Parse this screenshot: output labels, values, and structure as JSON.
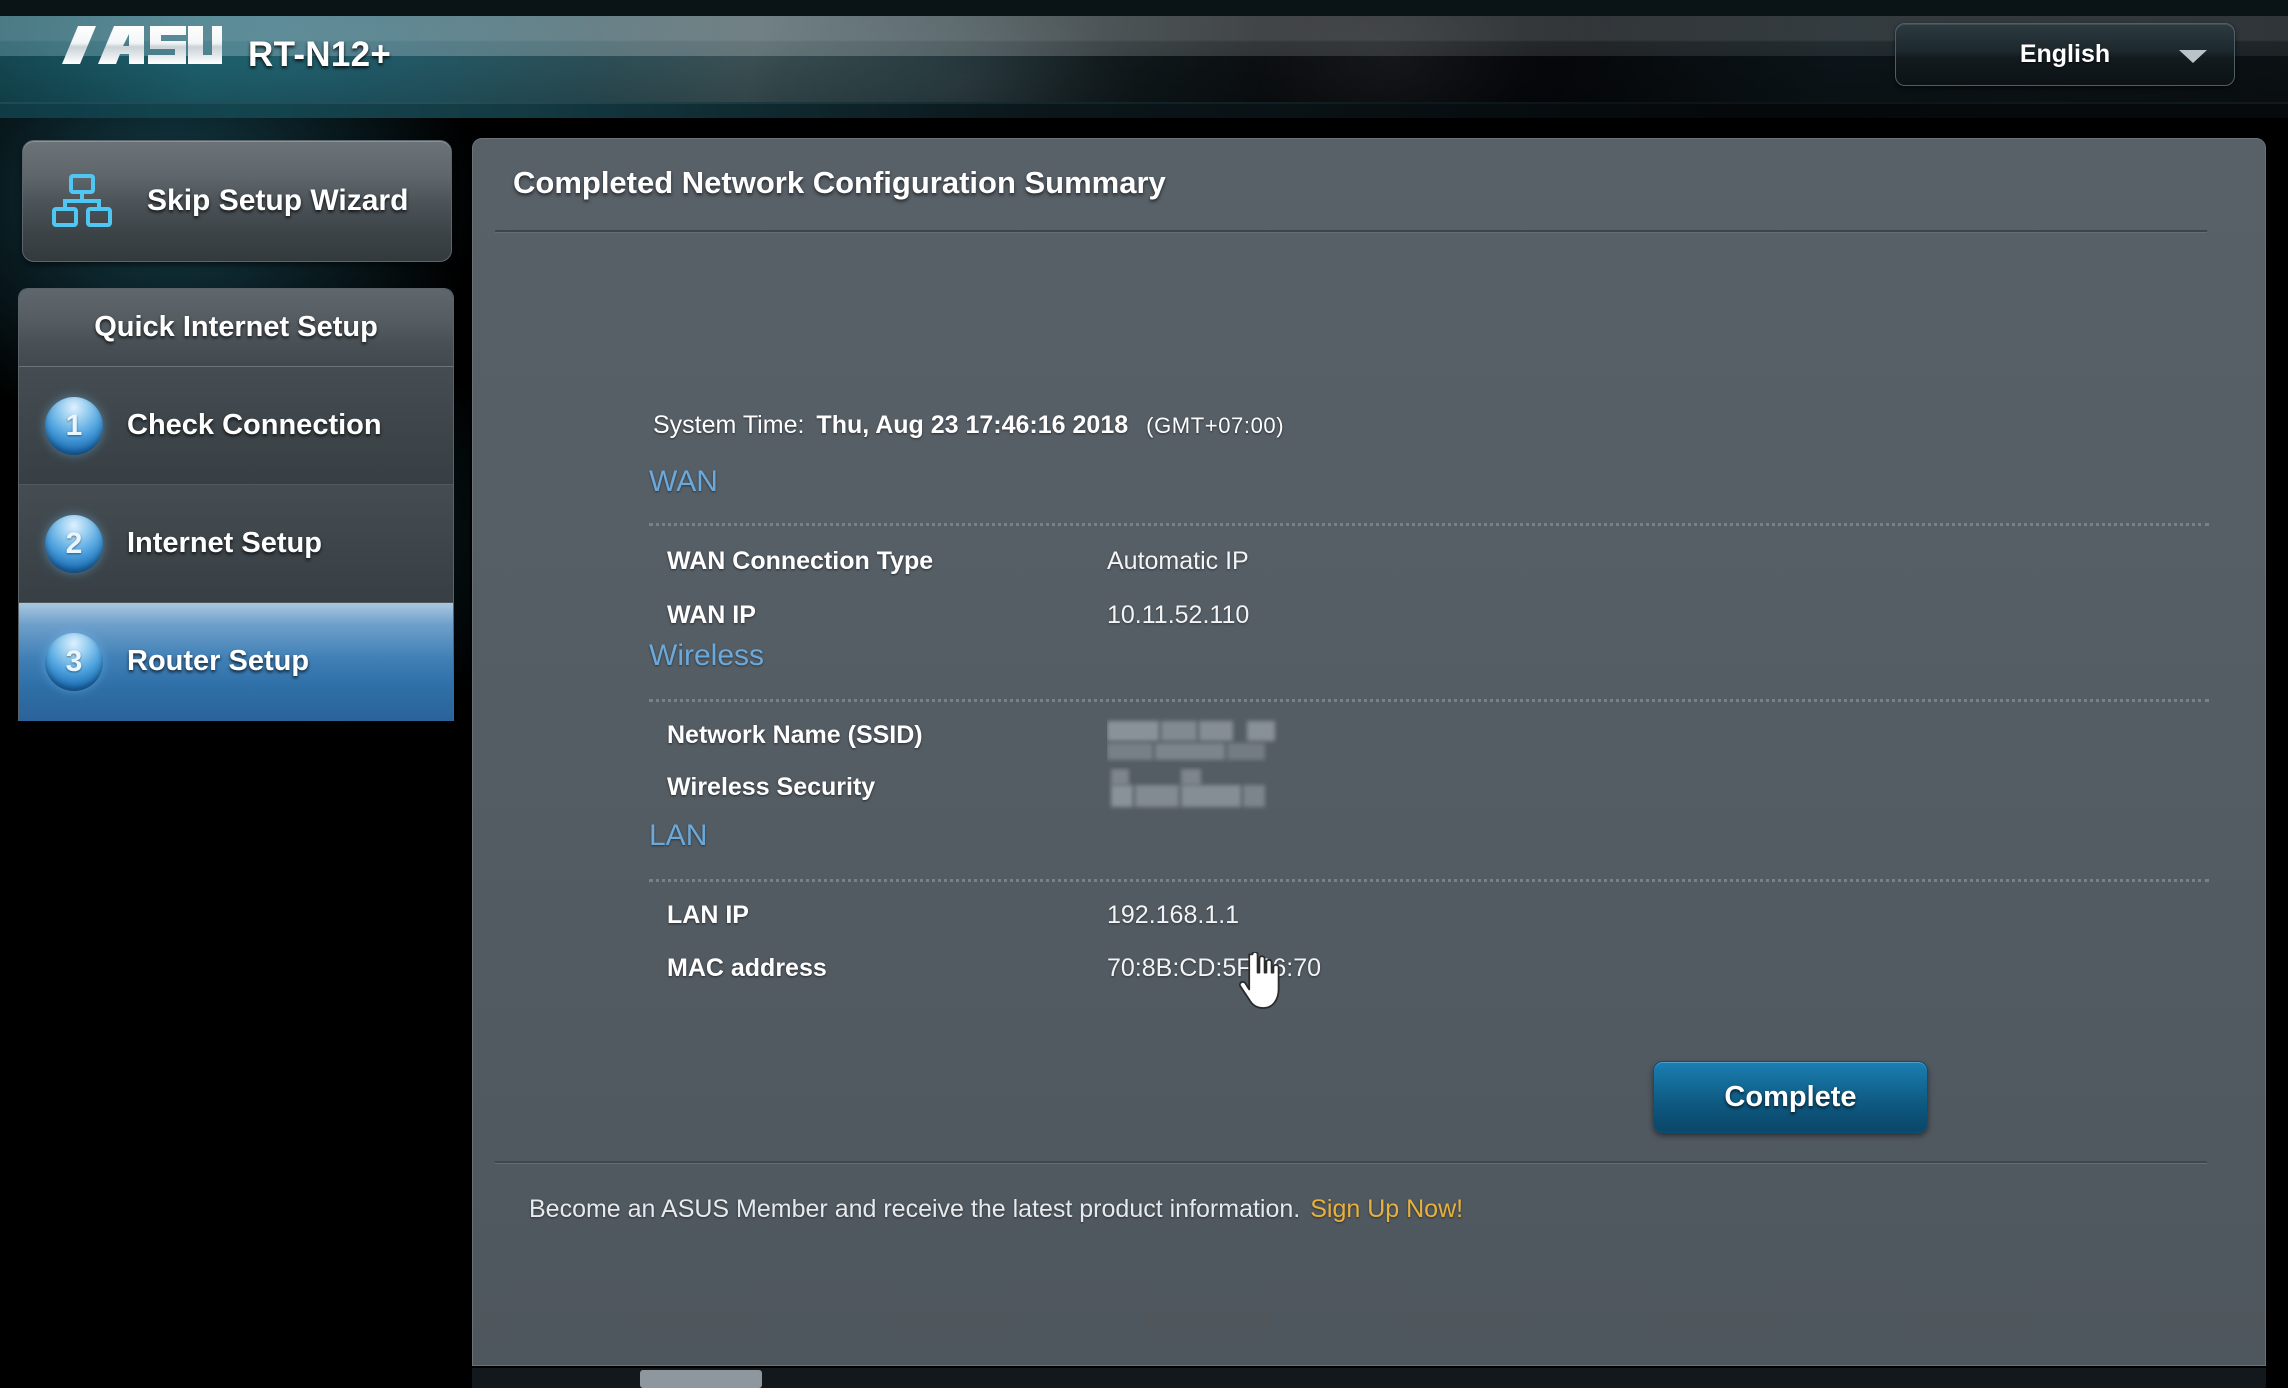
{
  "header": {
    "brand": "ASUS",
    "model": "RT-N12+",
    "language": {
      "selected": "English",
      "caret_icon": "chevron-down-icon"
    }
  },
  "sidebar": {
    "skip_wizard": {
      "label": "Skip Setup Wizard",
      "icon": "network-topology-icon"
    },
    "qis": {
      "title": "Quick Internet Setup",
      "steps": [
        {
          "num": "1",
          "label": "Check Connection",
          "active": false
        },
        {
          "num": "2",
          "label": "Internet Setup",
          "active": false
        },
        {
          "num": "3",
          "label": "Router Setup",
          "active": true
        }
      ]
    }
  },
  "main": {
    "title": "Completed Network Configuration Summary",
    "system_time": {
      "label": "System Time:",
      "value": "Thu, Aug 23 17:46:16 2018",
      "timezone": "(GMT+07:00)"
    },
    "sections": [
      {
        "name": "WAN",
        "rows": [
          {
            "key": "WAN Connection Type",
            "value": "Automatic IP",
            "redacted": false
          },
          {
            "key": "WAN IP",
            "value": "10.11.52.110",
            "redacted": false
          }
        ]
      },
      {
        "name": "Wireless",
        "rows": [
          {
            "key": "Network Name (SSID)",
            "value": "",
            "redacted": true
          },
          {
            "key": "Wireless Security",
            "value": "",
            "redacted": true
          }
        ]
      },
      {
        "name": "LAN",
        "rows": [
          {
            "key": "LAN IP",
            "value": "192.168.1.1",
            "redacted": false
          },
          {
            "key": "MAC address",
            "value": "70:8B:CD:5F:96:70",
            "redacted": false
          }
        ]
      }
    ],
    "complete_button": "Complete",
    "footer": {
      "text": "Become an ASUS Member and receive the latest product information.",
      "link": "Sign Up Now!"
    }
  },
  "colors": {
    "accent_blue": "#6ba9da",
    "link_orange": "#e8b13c",
    "panel_bg": "#586068",
    "active_step": "#3f7fb6",
    "button_blue": "#0f5c85"
  }
}
